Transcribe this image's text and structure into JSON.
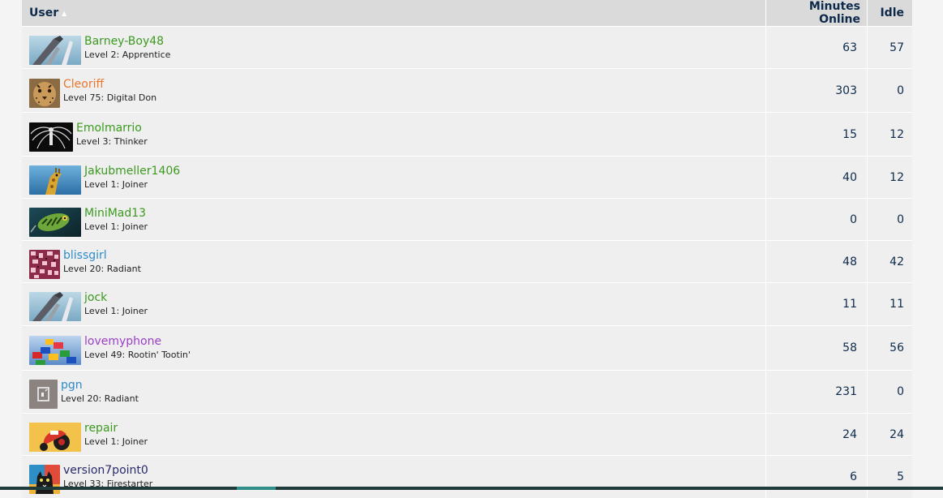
{
  "header": {
    "user": "User",
    "minutes_online": "Minutes Online",
    "idle": "Idle"
  },
  "rows": [
    {
      "name": "Barney-Boy48",
      "level": "Level 2: Apprentice",
      "minutes": "63",
      "idle": "57",
      "name_color": "#3c9a20",
      "avatar": "pen-knife"
    },
    {
      "name": "Cleoriff",
      "level": "Level 75: Digital Don",
      "minutes": "303",
      "idle": "0",
      "name_color": "#e8772e",
      "avatar": "cheetah"
    },
    {
      "name": "Emolmarrio",
      "level": "Level 3: Thinker",
      "minutes": "15",
      "idle": "12",
      "name_color": "#3c9a20",
      "avatar": "winged-figure"
    },
    {
      "name": "Jakubmeller1406",
      "level": "Level 1: Joiner",
      "minutes": "40",
      "idle": "12",
      "name_color": "#3c9a20",
      "avatar": "giraffe"
    },
    {
      "name": "MiniMad13",
      "level": "Level 1: Joiner",
      "minutes": "0",
      "idle": "0",
      "name_color": "#3c9a20",
      "avatar": "fishing-lure"
    },
    {
      "name": "blissgirl",
      "level": "Level 20: Radiant",
      "minutes": "48",
      "idle": "42",
      "name_color": "#2f8bc9",
      "avatar": "pink-pattern"
    },
    {
      "name": "jock",
      "level": "Level 1: Joiner",
      "minutes": "11",
      "idle": "11",
      "name_color": "#3c9a20",
      "avatar": "pen-knife"
    },
    {
      "name": "lovemyphone",
      "level": "Level 49: Rootin' Tootin'",
      "minutes": "58",
      "idle": "56",
      "name_color": "#9b3fc8",
      "avatar": "lego-bricks"
    },
    {
      "name": "pgn",
      "level": "Level 20: Radiant",
      "minutes": "231",
      "idle": "0",
      "name_color": "#2f8bc9",
      "avatar": "phone-placeholder"
    },
    {
      "name": "repair",
      "level": "Level 1: Joiner",
      "minutes": "24",
      "idle": "24",
      "name_color": "#3c9a20",
      "avatar": "red-robot"
    },
    {
      "name": "version7point0",
      "level": "Level 33: Firestarter",
      "minutes": "6",
      "idle": "5",
      "name_color": "#2a2a6a",
      "avatar": "cat"
    }
  ]
}
